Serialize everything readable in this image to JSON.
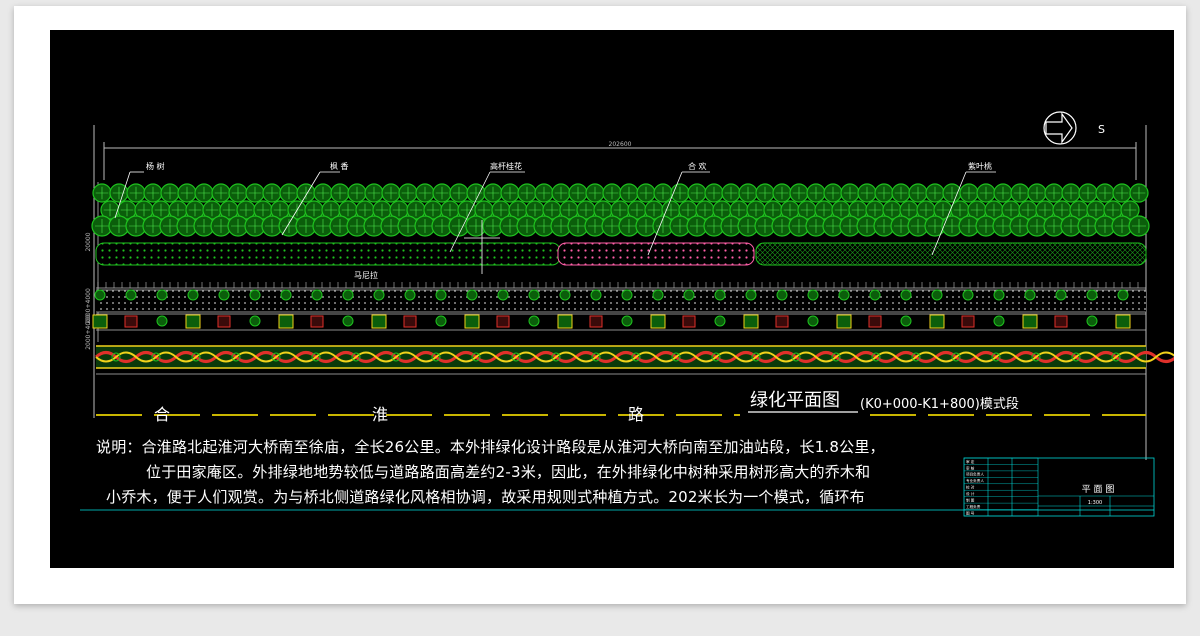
{
  "drawing": {
    "overall_dimension": "202600",
    "north_symbol": "S",
    "plant_labels": [
      "杨 树",
      "枫 香",
      "高杆桂花",
      "合 欢",
      "紫叶桃"
    ],
    "shrub_label": "马尼拉",
    "road_chars": [
      "合",
      "淮",
      "路"
    ],
    "title_main": "绿化平面图",
    "title_sub": "(K0+000-K1+800)模式段",
    "left_dims": [
      "20000",
      "2000+4000",
      "2000+4000"
    ]
  },
  "notes": {
    "line1": "说明：合淮路北起淮河大桥南至徐庙，全长26公里。本外排绿化设计路段是从淮河大桥向南至加油站段，长1.8公里，",
    "line2": "位于田家庵区。外排绿地地势较低与道路路面高差约2-3米，因此，在外排绿化中树种采用树形高大的乔木和",
    "line3": "小乔木，便于人们观赏。为与桥北侧道路绿化风格相协调，故采用规则式种植方式。202米长为一个模式，循环布"
  },
  "title_block": {
    "drawing_name": "平 面 图",
    "scale": "1:300",
    "row_labels": [
      "审 定",
      "审 核",
      "项目负责人",
      "专业负责人",
      "校 对",
      "设 计",
      "制 图",
      "工程负责",
      "图 号"
    ]
  },
  "colors": {
    "background": "#000000",
    "tree_green": "#1fc21f",
    "shrub_pink": "#ff5fa8",
    "hedge_red": "#e0302a",
    "hedge_yellow": "#f2d21a",
    "road_line_yellow": "#c9b500",
    "annotation_cyan": "#00d8d8"
  }
}
